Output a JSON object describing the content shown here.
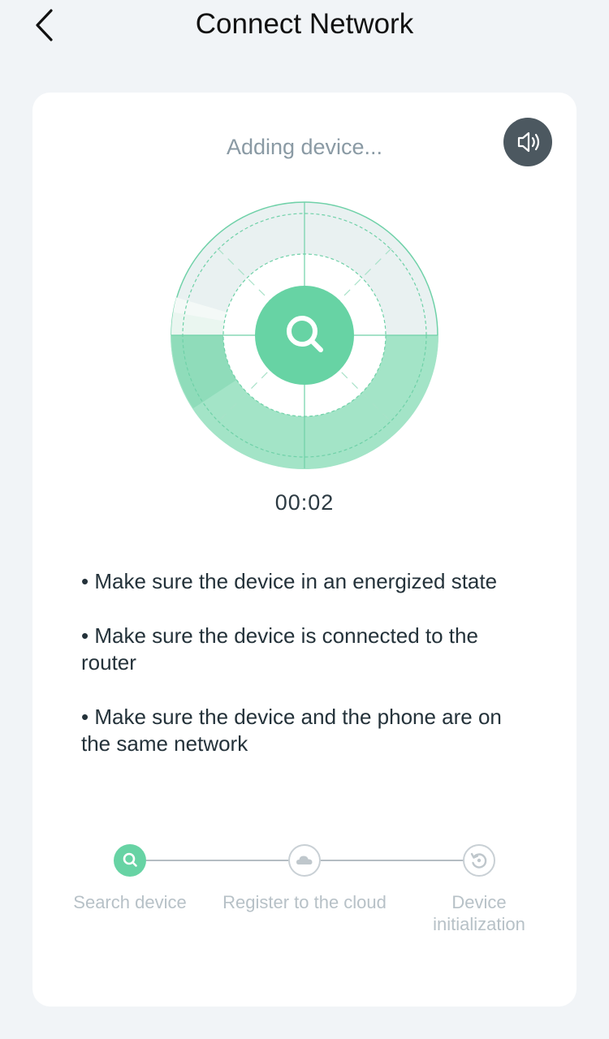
{
  "header": {
    "title": "Connect Network"
  },
  "card": {
    "status_text": "Adding device...",
    "timer": "00:02",
    "tips": [
      "• Make sure the device in an energized state",
      "• Make sure the device is connected to the router",
      "• Make sure the device and the phone are on the same network"
    ],
    "steps": [
      {
        "label": "Search device",
        "state": "active",
        "icon": "search-icon"
      },
      {
        "label": "Register to the cloud",
        "state": "pending",
        "icon": "cloud-icon"
      },
      {
        "label": "Device initialization",
        "state": "pending",
        "icon": "refresh-icon"
      }
    ]
  },
  "colors": {
    "accent": "#67d3a4",
    "background": "#f1f4f7",
    "card": "#ffffff",
    "sound_button": "#4c5860",
    "muted_text": "#8a9aa4"
  }
}
